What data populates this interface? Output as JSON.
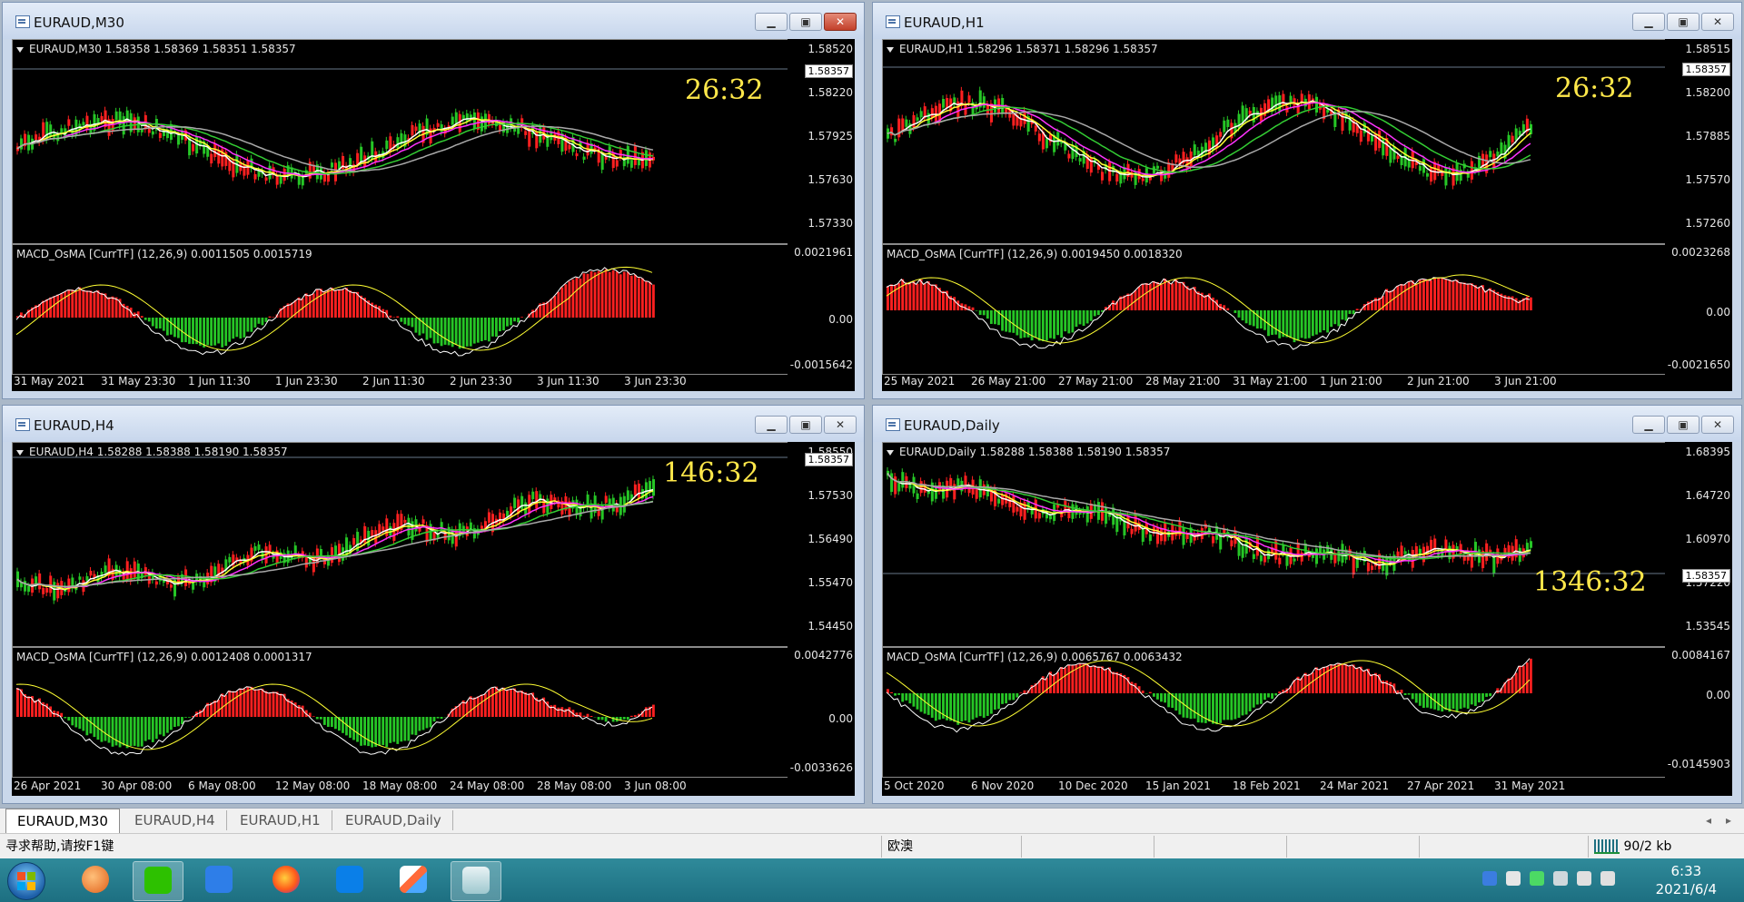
{
  "colors": {
    "bull": "#ff2020",
    "bear": "#26c626",
    "ma_white": "#ffffff",
    "ma_yellow": "#ffff33",
    "ma_magenta": "#ff33ff",
    "ma_green": "#33cc33",
    "ma_gray": "#a9a9a9",
    "timer": "#ffe84a"
  },
  "windows": [
    {
      "title": "EURAUD,M30",
      "info": "EURAUD,M30  1.58358 1.58369 1.58351 1.58357",
      "price_scale": [
        "1.58520",
        "1.58220",
        "1.57925",
        "1.57630",
        "1.57330"
      ],
      "current_price": "1.58357",
      "timer": "26:32",
      "macd_label": "MACD_OsMA [CurrTF] (12,26,9) 0.0011505 0.0015719",
      "macd_scale": [
        "0.0021961",
        "0.00",
        "-0.0015642"
      ],
      "time_axis": [
        "31 May 2021",
        "31 May 23:30",
        "1 Jun 11:30",
        "1 Jun 23:30",
        "2 Jun 11:30",
        "2 Jun 23:30",
        "3 Jun 11:30",
        "3 Jun 23:30"
      ]
    },
    {
      "title": "EURAUD,H1",
      "info": "EURAUD,H1  1.58296 1.58371 1.58296 1.58357",
      "price_scale": [
        "1.58515",
        "1.58200",
        "1.57885",
        "1.57570",
        "1.57260"
      ],
      "current_price": "1.58357",
      "timer": "26:32",
      "macd_label": "MACD_OsMA [CurrTF] (12,26,9) 0.0019450 0.0018320",
      "macd_scale": [
        "0.0023268",
        "0.00",
        "-0.0021650"
      ],
      "time_axis": [
        "25 May 2021",
        "26 May 21:00",
        "27 May 21:00",
        "28 May 21:00",
        "31 May 21:00",
        "1 Jun 21:00",
        "2 Jun 21:00",
        "3 Jun 21:00"
      ]
    },
    {
      "title": "EURAUD,H4",
      "info": "EURAUD,H4  1.58288 1.58388 1.58190 1.58357",
      "price_scale": [
        "1.58550",
        "1.57530",
        "1.56490",
        "1.55470",
        "1.54450"
      ],
      "current_price": "1.58357",
      "timer": "146:32",
      "macd_label": "MACD_OsMA [CurrTF] (12,26,9) 0.0012408 0.0001317",
      "macd_scale": [
        "0.0042776",
        "0.00",
        "-0.0033626"
      ],
      "time_axis": [
        "26 Apr 2021",
        "30 Apr 08:00",
        "6 May 08:00",
        "12 May 08:00",
        "18 May 08:00",
        "24 May 08:00",
        "28 May 08:00",
        "3 Jun 08:00"
      ]
    },
    {
      "title": "EURAUD,Daily",
      "info": "EURAUD,Daily  1.58288 1.58388 1.58190 1.58357",
      "price_scale": [
        "1.68395",
        "1.64720",
        "1.60970",
        "1.57220",
        "1.53545"
      ],
      "current_price": "1.58357",
      "timer": "1346:32",
      "macd_label": "MACD_OsMA [CurrTF] (12,26,9) 0.0065767 0.0063432",
      "macd_scale": [
        "0.0084167",
        "0.00",
        "-0.0145903"
      ],
      "time_axis": [
        "5 Oct 2020",
        "6 Nov 2020",
        "10 Dec 2020",
        "15 Jan 2021",
        "18 Feb 2021",
        "24 Mar 2021",
        "27 Apr 2021",
        "31 May 2021"
      ]
    }
  ],
  "tabs": [
    "EURAUD,M30",
    "EURAUD,H4",
    "EURAUD,H1",
    "EURAUD,Daily"
  ],
  "status": {
    "help": "寻求帮助,请按F1键",
    "profile": "欧澳",
    "traffic": "90/2 kb"
  },
  "clock": {
    "time": "6:33",
    "date": "2021/6/4"
  }
}
